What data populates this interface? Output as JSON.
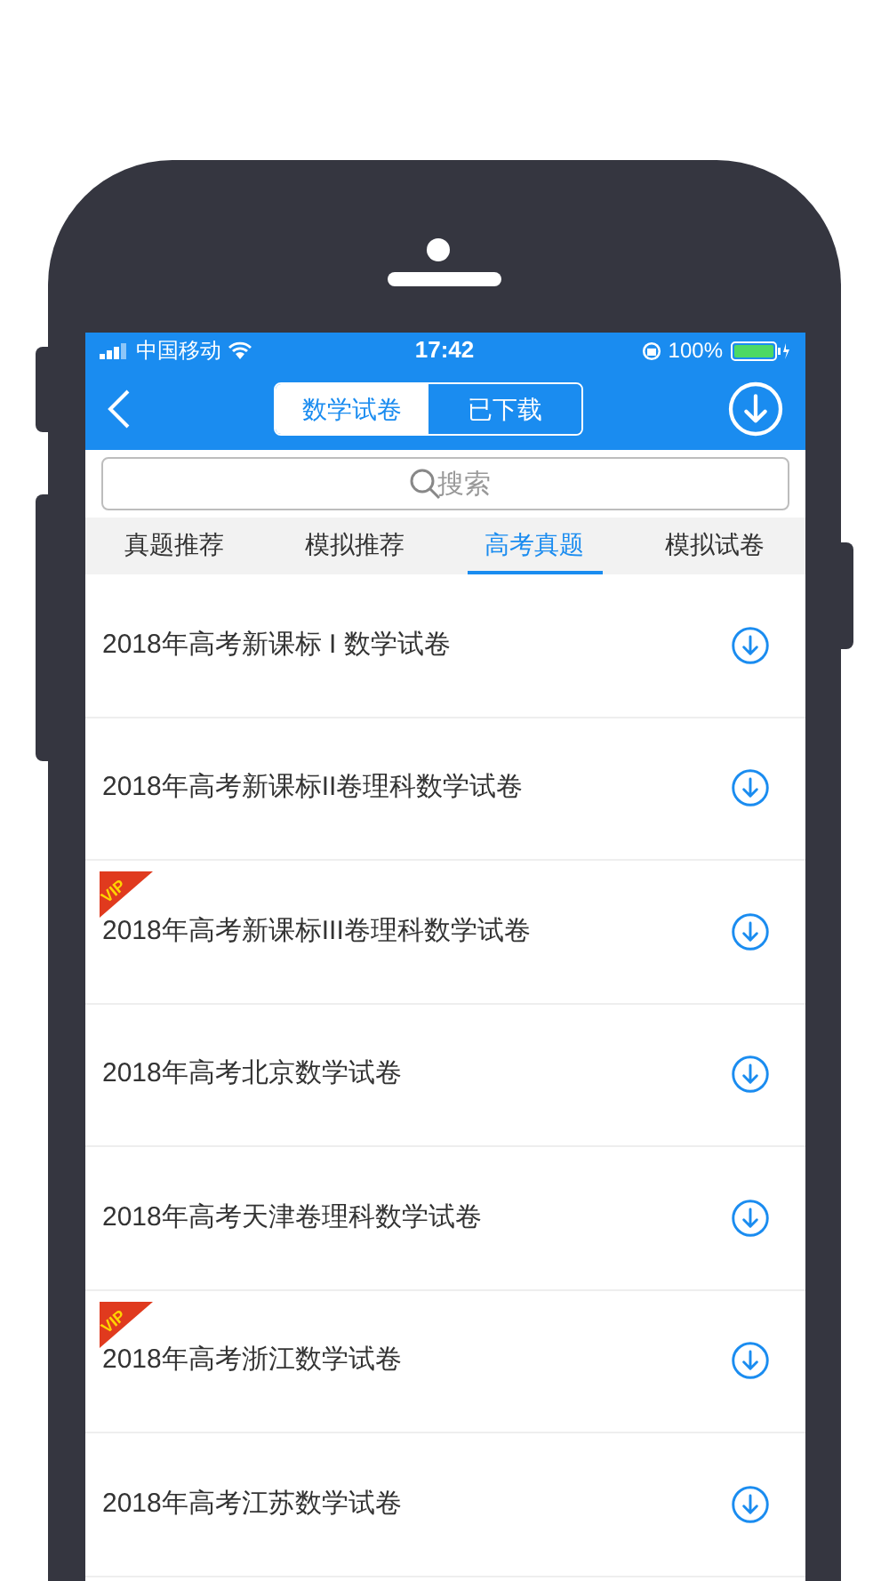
{
  "status_bar": {
    "carrier": "中国移动",
    "time": "17:42",
    "battery": "100%"
  },
  "segments": [
    {
      "label": "数学试卷",
      "selected": true
    },
    {
      "label": "已下载",
      "selected": false
    }
  ],
  "search": {
    "placeholder": "搜索"
  },
  "tabs": [
    {
      "label": "真题推荐",
      "selected": false
    },
    {
      "label": "模拟推荐",
      "selected": false
    },
    {
      "label": "高考真题",
      "selected": true
    },
    {
      "label": "模拟试卷",
      "selected": false
    }
  ],
  "papers": [
    {
      "title": "2018年高考新课标 I 数学试卷",
      "vip": false
    },
    {
      "title": "2018年高考新课标II卷理科数学试卷",
      "vip": false
    },
    {
      "title": "2018年高考新课标III卷理科数学试卷",
      "vip": true,
      "badge": "VIP"
    },
    {
      "title": "2018年高考北京数学试卷",
      "vip": false
    },
    {
      "title": "2018年高考天津卷理科数学试卷",
      "vip": false
    },
    {
      "title": "2018年高考浙江数学试卷",
      "vip": true,
      "badge": "VIP"
    },
    {
      "title": "2018年高考江苏数学试卷",
      "vip": false
    }
  ]
}
